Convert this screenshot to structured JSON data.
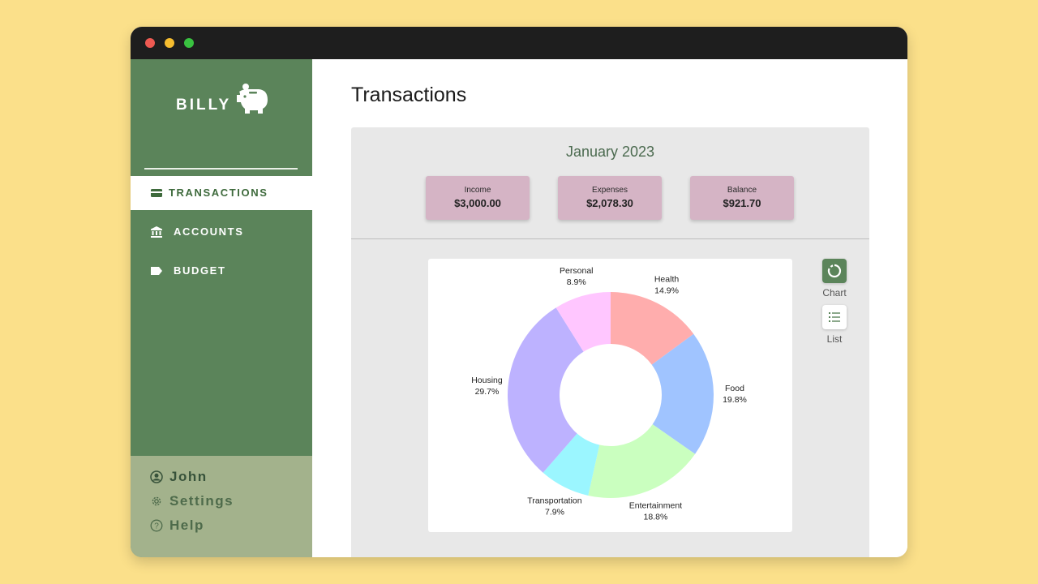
{
  "app": {
    "brand": "BILLY"
  },
  "sidebar": {
    "items": [
      {
        "label": "TRANSACTIONS",
        "icon": "credit-card-icon",
        "active": true
      },
      {
        "label": "ACCOUNTS",
        "icon": "bank-icon",
        "active": false
      },
      {
        "label": "BUDGET",
        "icon": "tag-icon",
        "active": false
      }
    ],
    "footer": {
      "user": "John",
      "settings": "Settings",
      "help": "Help"
    }
  },
  "main": {
    "title": "Transactions",
    "month": "January 2023",
    "summary": [
      {
        "label": "Income",
        "value": "$3,000.00"
      },
      {
        "label": "Expenses",
        "value": "$2,078.30"
      },
      {
        "label": "Balance",
        "value": "$921.70"
      }
    ],
    "views": {
      "chart": "Chart",
      "list": "List"
    }
  },
  "colors": {
    "sidebar": "#5b845a",
    "sidebar_footer": "#a3b28c",
    "card": "#d5b4c5",
    "background": "#fbe08a"
  },
  "chart_data": {
    "type": "pie",
    "donut": true,
    "categories": [
      "Health",
      "Food",
      "Entertainment",
      "Transportation",
      "Housing",
      "Personal"
    ],
    "values": [
      14.9,
      19.8,
      18.8,
      7.9,
      29.7,
      8.9
    ],
    "value_labels": [
      "14.9%",
      "19.8%",
      "18.8%",
      "7.9%",
      "29.7%",
      "8.9%"
    ],
    "colors": [
      "#ffadad",
      "#a0c4ff",
      "#caffbf",
      "#9bf6ff",
      "#bdb2ff",
      "#ffc6ff"
    ]
  }
}
